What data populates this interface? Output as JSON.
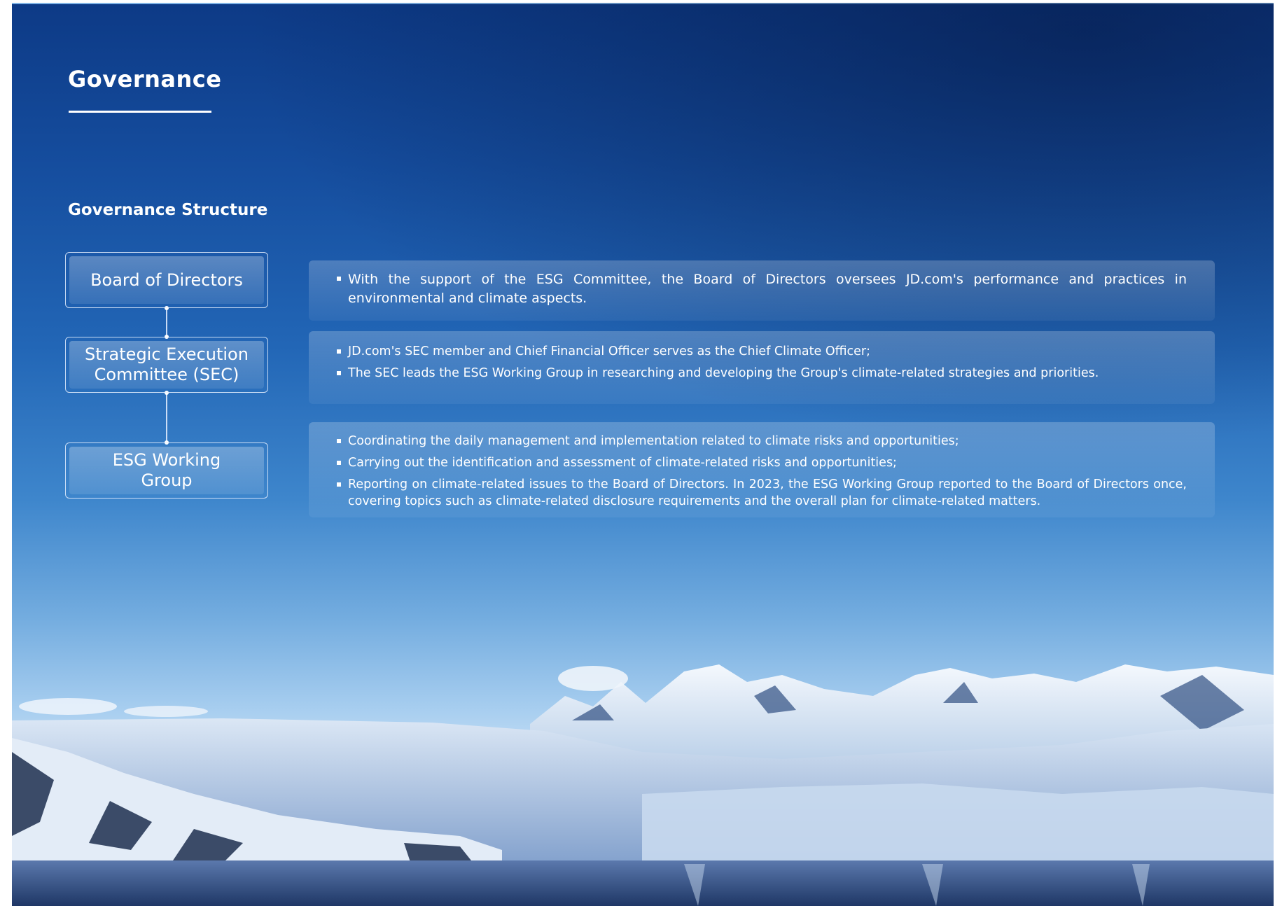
{
  "page": {
    "title": "Governance",
    "section_title": "Governance Structure"
  },
  "structure": {
    "nodes": [
      {
        "label": "Board of Directors"
      },
      {
        "label": "Strategic Execution Committee (SEC)"
      },
      {
        "label": "ESG Working Group"
      }
    ]
  },
  "panels": {
    "board": {
      "items": [
        "With the support of the ESG Committee, the Board of Directors oversees JD.com's performance and practices in environmental and climate aspects."
      ]
    },
    "sec": {
      "items": [
        "JD.com's SEC member and Chief Financial Officer serves as the Chief Climate Officer;",
        "The SEC leads the ESG Working Group in researching and developing the Group's climate-related strategies and priorities."
      ]
    },
    "esg": {
      "items": [
        "Coordinating the daily management and implementation related to climate risks and opportunities;",
        "Carrying out the identification and assessment of climate-related risks and opportunities;",
        "Reporting on climate-related issues to the Board of Directors. In 2023, the ESG Working Group reported to the Board of Directors once, covering topics such as climate-related disclosure requirements and the overall plan for climate-related matters."
      ]
    }
  },
  "colors": {
    "sky_top": "#0d3a86",
    "sky_bottom": "#c7e0f6",
    "text": "#ffffff"
  }
}
